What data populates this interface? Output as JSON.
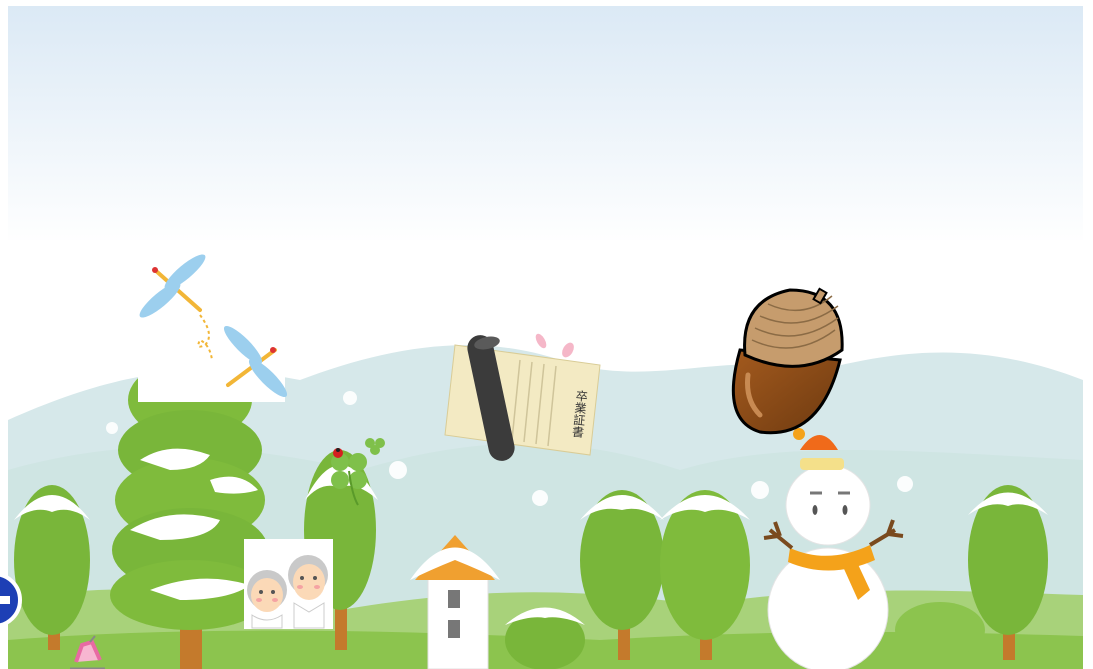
{
  "scene": {
    "type": "winter-hilltop",
    "colors": {
      "sky_top": "#dbe9f5",
      "sky_bottom": "#ffffff",
      "hills_far": "#c8dfe2",
      "hills_mid": "#a9d28b",
      "hills_near": "#8cc44e",
      "tree_green": "#79b63a",
      "trunk": "#c47a2c",
      "snow": "#ffffff",
      "roof": "#f0a030",
      "acorn_body": "#8b4a16",
      "acorn_cap": "#c69c6d",
      "scarf": "#f4a21a",
      "side_button": "#1d3fb5"
    }
  },
  "items": [
    {
      "id": "dragonflies",
      "icon": "dragonfly-icon"
    },
    {
      "id": "graduation-certificate",
      "icon": "diploma-icon",
      "scroll_text": "卒業証書"
    },
    {
      "id": "acorn",
      "icon": "acorn-icon"
    },
    {
      "id": "snowman",
      "icon": "snowman-icon"
    },
    {
      "id": "four-leaf-clover",
      "icon": "clover-icon"
    },
    {
      "id": "grandparents",
      "icon": "elderly-couple-icon"
    },
    {
      "id": "pink-stroller",
      "icon": "stroller-icon"
    }
  ],
  "side_button": {
    "icon": "minus-circle-icon"
  }
}
